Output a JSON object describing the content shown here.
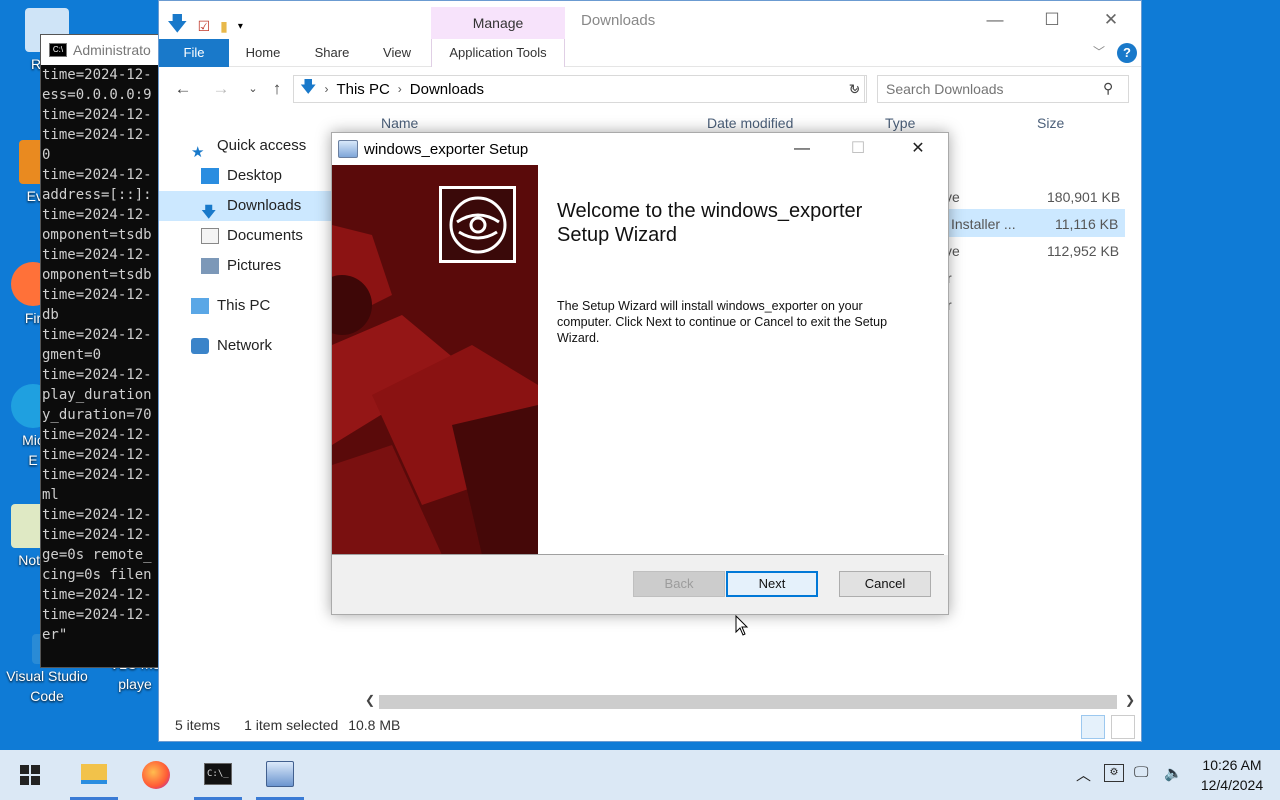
{
  "desktop": {
    "icons": [
      {
        "label": "Recy"
      },
      {
        "label": "Ever"
      },
      {
        "label": "Fir"
      },
      {
        "label": "Mic\nE"
      },
      {
        "label": "Note"
      },
      {
        "label": "Visual Studio\nCode"
      },
      {
        "label": "VLC me\nplaye"
      }
    ]
  },
  "console": {
    "title": "Administrato",
    "lines": "time=2024-12-\ness=0.0.0.0:9\ntime=2024-12-\ntime=2024-12-\n0\ntime=2024-12-\naddress=[::]:\ntime=2024-12-\nomponent=tsdb\ntime=2024-12-\nomponent=tsdb\ntime=2024-12-\ndb\ntime=2024-12-\ngment=0\ntime=2024-12-\nplay_duration\ny_duration=70\ntime=2024-12-\ntime=2024-12-\ntime=2024-12-\nml\ntime=2024-12-\ntime=2024-12-\nge=0s remote_\ncing=0s filen\ntime=2024-12-\ntime=2024-12-\ner\""
  },
  "explorer": {
    "context_tab": "Manage",
    "window_title": "Downloads",
    "ribbon_tabs": {
      "file": "File",
      "home": "Home",
      "share": "Share",
      "view": "View",
      "app_tools": "Application Tools"
    },
    "address": {
      "root": "This PC",
      "folder": "Downloads"
    },
    "search_placeholder": "Search Downloads",
    "nav": {
      "quick_access": "Quick access",
      "desktop": "Desktop",
      "downloads": "Downloads",
      "documents": "Documents",
      "pictures": "Pictures",
      "this_pc": "This PC",
      "network": "Network"
    },
    "columns": {
      "name": "Name",
      "date": "Date modified",
      "type": "Type",
      "size": "Size"
    },
    "files": [
      {
        "type": "ve",
        "size": "180,901 KB"
      },
      {
        "type": "Installer ...",
        "size": "11,116 KB"
      },
      {
        "type": "ve",
        "size": "112,952 KB"
      },
      {
        "type": "r",
        "size": ""
      },
      {
        "type": "r",
        "size": ""
      }
    ],
    "status": {
      "items": "5 items",
      "selected": "1 item selected",
      "size": "10.8 MB"
    }
  },
  "setup": {
    "title": "windows_exporter Setup",
    "heading": "Welcome to the windows_exporter Setup Wizard",
    "body": "The Setup Wizard will install windows_exporter on your computer. Click Next to continue or Cancel to exit the Setup Wizard.",
    "buttons": {
      "back": "Back",
      "next": "Next",
      "cancel": "Cancel"
    }
  },
  "taskbar": {
    "time": "10:26 AM",
    "date": "12/4/2024"
  },
  "colors": {
    "desktop": "#0f7bd6",
    "accent": "#1979ca",
    "banner": "#6b0d0d",
    "taskbar": "#dbe8f5"
  }
}
